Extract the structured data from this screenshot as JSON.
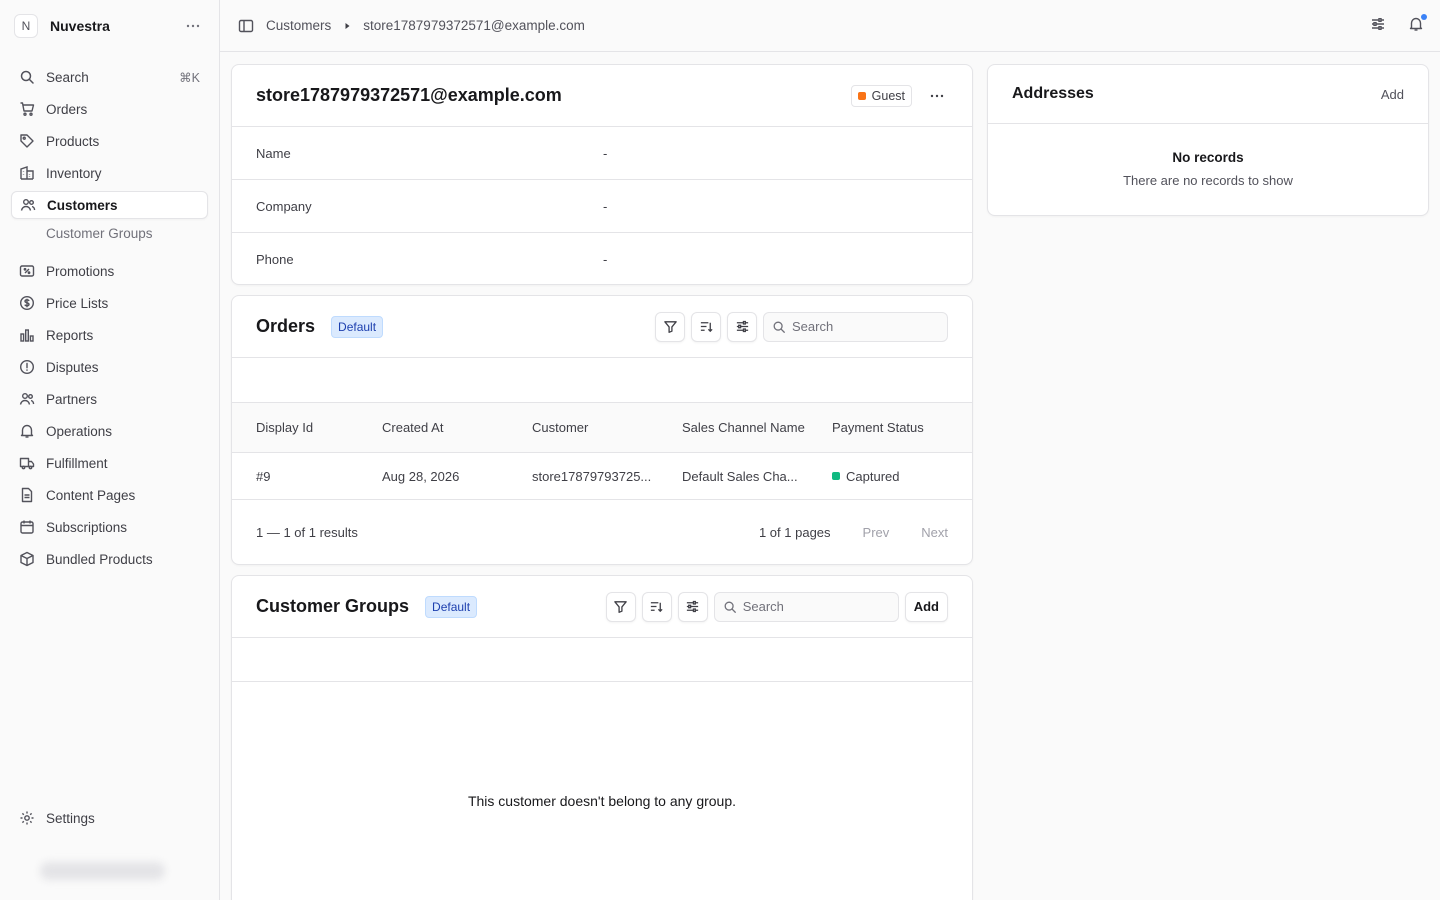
{
  "store": {
    "avatar_letter": "N",
    "name": "Nuvestra"
  },
  "sidebar": {
    "search": {
      "label": "Search",
      "shortcut": "⌘K"
    },
    "items": [
      {
        "label": "Orders",
        "icon": "cart-icon"
      },
      {
        "label": "Products",
        "icon": "tag-icon"
      },
      {
        "label": "Inventory",
        "icon": "building-icon"
      },
      {
        "label": "Customers",
        "icon": "users-icon",
        "active": true
      },
      {
        "label": "Promotions",
        "icon": "receipt-percent-icon"
      },
      {
        "label": "Price Lists",
        "icon": "currency-dollar-icon"
      },
      {
        "label": "Reports",
        "icon": "bar-chart-icon"
      },
      {
        "label": "Disputes",
        "icon": "exclamation-circle-icon"
      },
      {
        "label": "Partners",
        "icon": "users-icon"
      },
      {
        "label": "Operations",
        "icon": "bell-icon"
      },
      {
        "label": "Fulfillment",
        "icon": "truck-icon"
      },
      {
        "label": "Content Pages",
        "icon": "document-icon"
      },
      {
        "label": "Subscriptions",
        "icon": "calendar-icon"
      },
      {
        "label": "Bundled Products",
        "icon": "cube-icon"
      }
    ],
    "sub_item": "Customer Groups",
    "settings": "Settings"
  },
  "breadcrumb": {
    "section": "Customers",
    "current": "store1787979372571@example.com"
  },
  "customer": {
    "email": "store1787979372571@example.com",
    "badge": "Guest",
    "badge_color": "#f97316",
    "fields": [
      {
        "label": "Name",
        "value": "-"
      },
      {
        "label": "Company",
        "value": "-"
      },
      {
        "label": "Phone",
        "value": "-"
      }
    ]
  },
  "orders": {
    "title": "Orders",
    "badge": "Default",
    "search_placeholder": "Search",
    "columns": [
      "Display Id",
      "Created At",
      "Customer",
      "Sales Channel Name",
      "Payment Status"
    ],
    "rows": [
      {
        "display_id": "#9",
        "created_at": "Aug 28, 2026",
        "customer": "store17879793725...",
        "channel": "Default Sales Cha...",
        "payment_status": "Captured",
        "status_color": "#10b981"
      }
    ],
    "pagination": {
      "range": "1 — 1 of 1 results",
      "pages": "1 of 1 pages",
      "prev": "Prev",
      "next": "Next"
    }
  },
  "customer_groups": {
    "title": "Customer Groups",
    "badge": "Default",
    "search_placeholder": "Search",
    "add_label": "Add",
    "empty": "This customer doesn't belong to any group."
  },
  "addresses": {
    "title": "Addresses",
    "add_label": "Add",
    "empty_title": "No records",
    "empty_text": "There are no records to show"
  }
}
